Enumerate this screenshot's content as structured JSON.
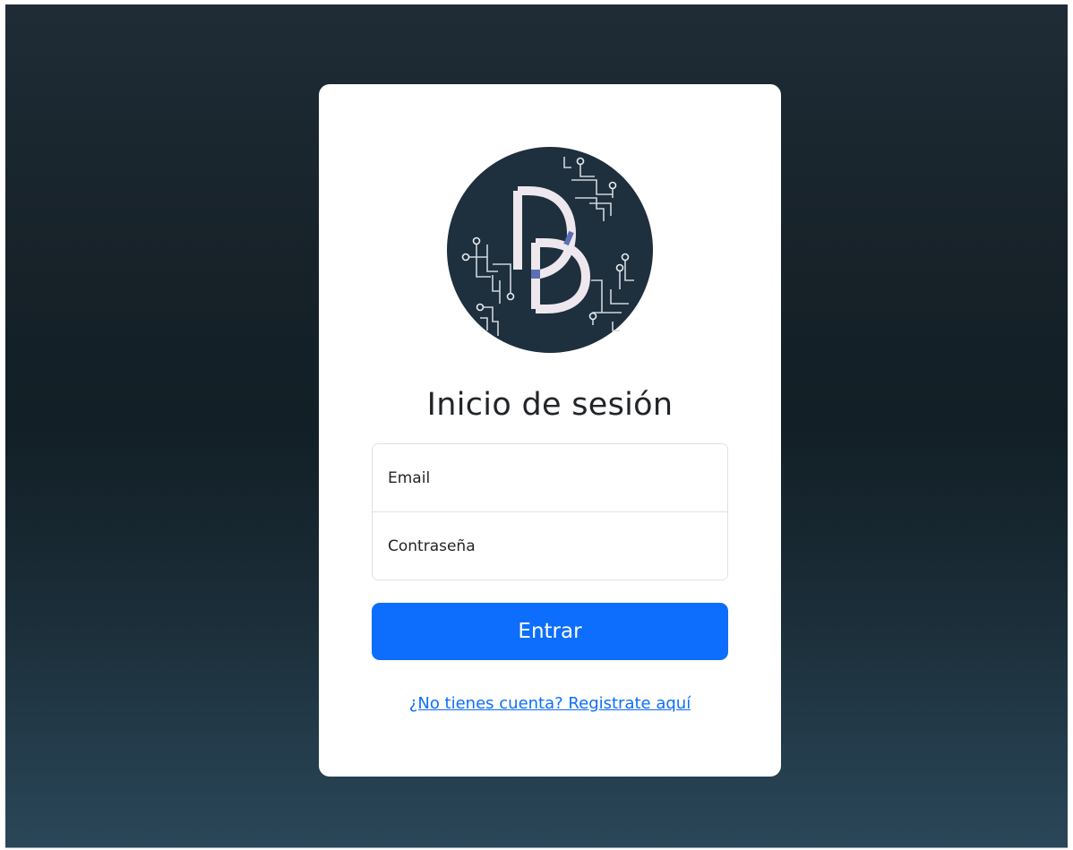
{
  "login": {
    "title": "Inicio de sesión",
    "email_placeholder": "Email",
    "password_placeholder": "Contraseña",
    "submit_label": "Entrar",
    "register_link": "¿No tienes cuenta? Registrate aquí"
  },
  "logo": {
    "icon": "dd-circuit-logo",
    "letters": "DD"
  },
  "colors": {
    "accent": "#0d6efd",
    "logo_bg": "#1e2f3d",
    "logo_letter": "#efe7ee",
    "logo_accent": "#5b6fb5",
    "background_top": "#1f2c36",
    "background_bottom": "#2a4759"
  }
}
